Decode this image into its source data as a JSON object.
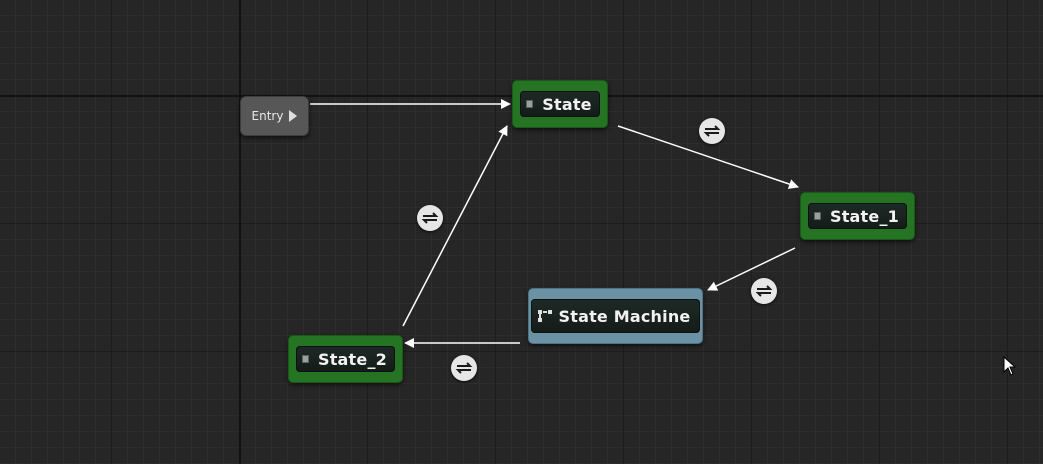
{
  "graph": {
    "entry": {
      "label": "Entry"
    },
    "nodes": {
      "state": {
        "label": "State"
      },
      "state_1": {
        "label": "State_1"
      },
      "state_2": {
        "label": "State_2"
      },
      "state_machine": {
        "label": "State Machine"
      }
    },
    "colors": {
      "state_node": "#247423",
      "state_machine_node": "#6b91a5",
      "entry_node": "#575757",
      "wire": "#ffffff",
      "background": "#262626"
    }
  }
}
